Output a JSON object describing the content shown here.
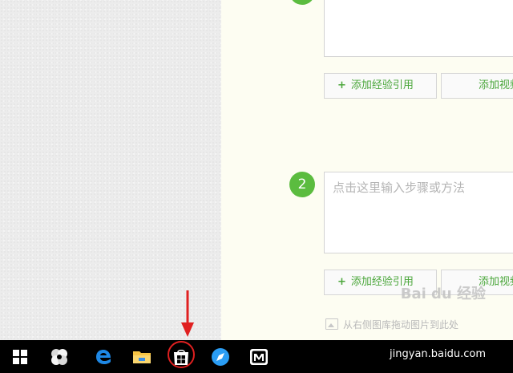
{
  "editor": {
    "step2_number": "2",
    "step2_placeholder": "点击这里输入步骤或方法",
    "add_experience_ref_label": "添加经验引用",
    "add_video_label": "添加视频",
    "plus_glyph": "+",
    "image_hint": "从右侧图库拖动图片到此处"
  },
  "watermark": {
    "brand": "Bai du 经验",
    "url": "jingyan.baidu.com"
  },
  "taskbar": {
    "icons": [
      "windows-start-icon",
      "pinwheel-app-icon",
      "edge-icon",
      "file-explorer-icon",
      "store-icon",
      "browser-app-icon",
      "mangotv-icon"
    ]
  },
  "colors": {
    "accent_green": "#5bbc3f",
    "highlight_red": "#e02020"
  }
}
